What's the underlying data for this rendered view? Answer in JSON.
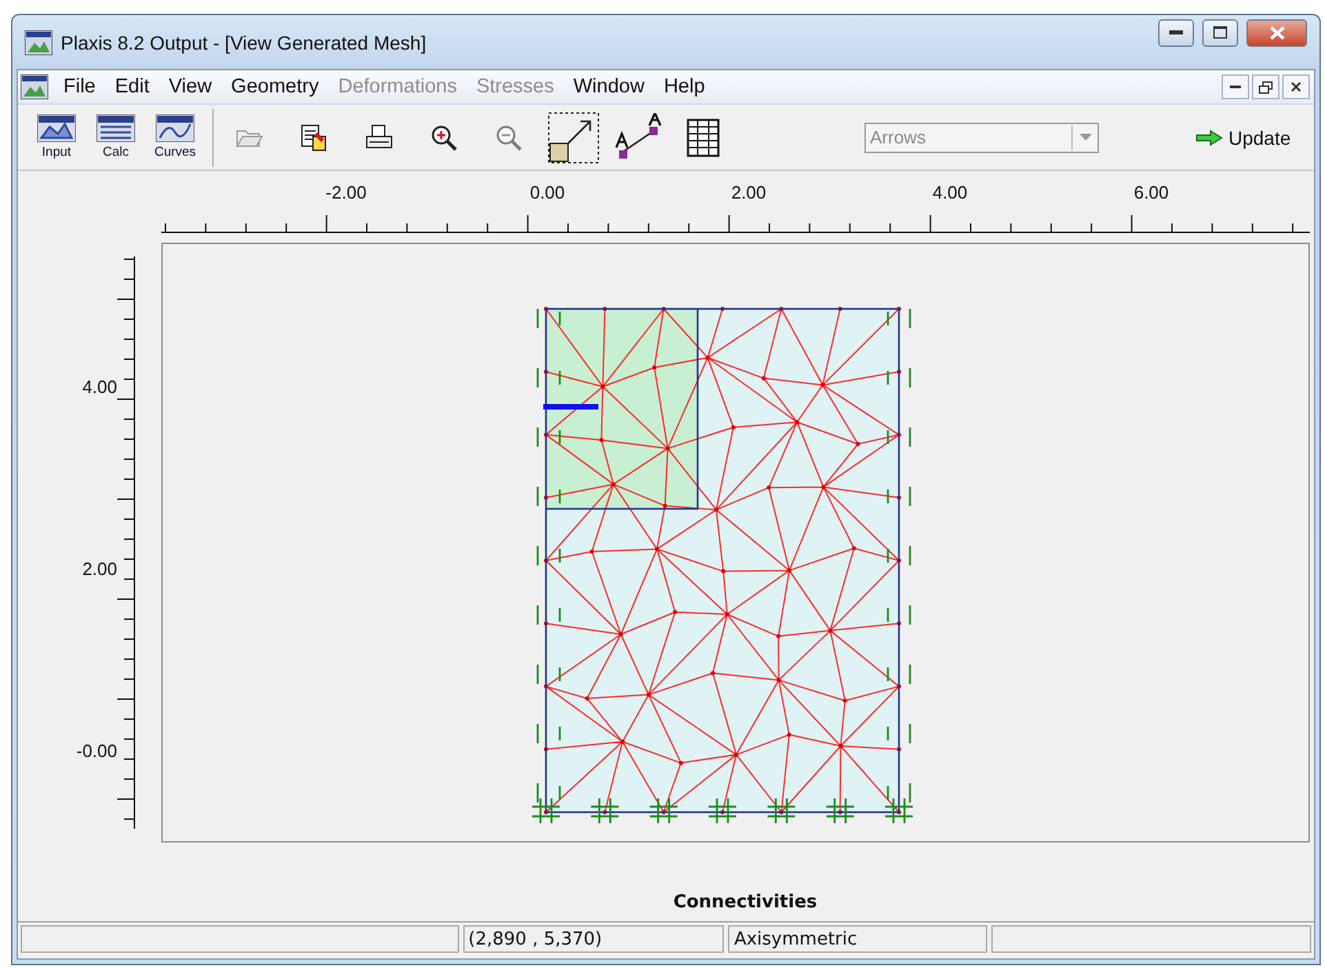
{
  "window": {
    "title": "Plaxis 8.2 Output - [View Generated Mesh]"
  },
  "menu": [
    {
      "label": "File",
      "disabled": false
    },
    {
      "label": "Edit",
      "disabled": false
    },
    {
      "label": "View",
      "disabled": false
    },
    {
      "label": "Geometry",
      "disabled": false
    },
    {
      "label": "Deformations",
      "disabled": true
    },
    {
      "label": "Stresses",
      "disabled": true
    },
    {
      "label": "Window",
      "disabled": false
    },
    {
      "label": "Help",
      "disabled": false
    }
  ],
  "program_buttons": [
    {
      "label": "Input"
    },
    {
      "label": "Calc"
    },
    {
      "label": "Curves"
    }
  ],
  "tools": [
    {
      "kind": "open",
      "disabled": true
    },
    {
      "kind": "report",
      "disabled": false
    },
    {
      "kind": "print",
      "disabled": false
    },
    {
      "kind": "zoom-in",
      "disabled": false
    },
    {
      "kind": "zoom-out",
      "disabled": true
    },
    {
      "kind": "select",
      "disabled": false
    },
    {
      "kind": "cross-section",
      "disabled": false
    },
    {
      "kind": "table",
      "disabled": false
    }
  ],
  "dropdown": {
    "value": "Arrows",
    "disabled": true
  },
  "update_button": {
    "label": "Update"
  },
  "ruler_x": {
    "labels": [
      "-2.00",
      "0.00",
      "2.00",
      "4.00",
      "6.00"
    ]
  },
  "ruler_y": {
    "labels": [
      "4.00",
      "2.00",
      "-0.00"
    ]
  },
  "caption": "Connectivities",
  "status_bar": {
    "coordinates": "(2,890 , 5,370)",
    "mode": "Axisymmetric"
  }
}
